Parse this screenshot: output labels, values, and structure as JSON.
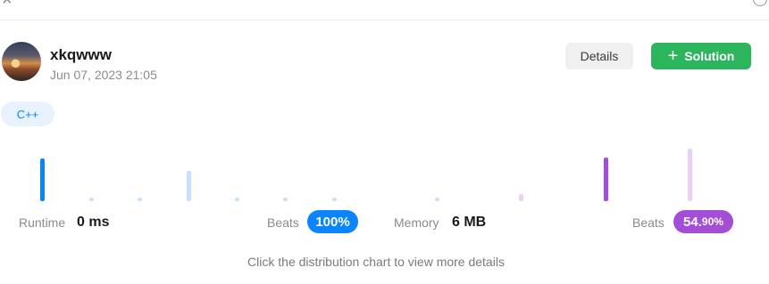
{
  "header": {
    "username": "xkqwww",
    "timestamp": "Jun 07, 2023 21:05"
  },
  "actions": {
    "details_label": "Details",
    "solution_label": "Solution"
  },
  "language_tag": "C++",
  "stats": {
    "runtime": {
      "label": "Runtime",
      "value": "0 ms",
      "beats_label": "Beats",
      "beats_value": "100%"
    },
    "memory": {
      "label": "Memory",
      "value": "6 MB",
      "beats_main": "54.",
      "beats_small": "90%",
      "beats_label": "Beats"
    }
  },
  "footer_note": "Click the distribution chart to view more details",
  "colors": {
    "accent_blue": "#0a84ff",
    "accent_purple": "#a44ed8",
    "bar_blue_light": "#c8e0ff",
    "bar_purple_light": "#ead0f7",
    "solution_green": "#2db55d"
  },
  "icons": {
    "close": "close-icon",
    "refresh": "refresh-icon",
    "plus": "plus-icon"
  }
}
